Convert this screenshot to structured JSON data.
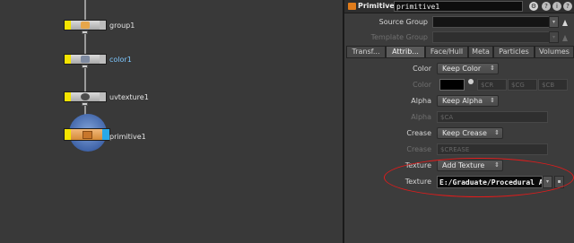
{
  "network": {
    "nodes": [
      {
        "name": "group1"
      },
      {
        "name": "color1"
      },
      {
        "name": "uvtexture1"
      },
      {
        "name": "primitive1"
      }
    ]
  },
  "panel": {
    "node_type": "Primitive",
    "node_name": "primitive1",
    "source_group_label": "Source Group",
    "template_group_label": "Template Group",
    "tabs": [
      "Transf...",
      "Attrib...",
      "Face/Hull",
      "Meta",
      "Particles",
      "Volumes"
    ],
    "active_tab": "Attrib...",
    "params": {
      "color_mode_label": "Color",
      "color_mode_value": "Keep Color",
      "color_label": "Color",
      "color_fields": [
        "$CR",
        "$CG",
        "$CB"
      ],
      "alpha_mode_label": "Alpha",
      "alpha_mode_value": "Keep Alpha",
      "alpha_label": "Alpha",
      "alpha_field": "$CA",
      "crease_mode_label": "Crease",
      "crease_mode_value": "Keep Crease",
      "crease_label": "Crease",
      "crease_field": "$CREASE",
      "texture_mode_label": "Texture",
      "texture_mode_value": "Add Texture",
      "texture_label": "Texture",
      "texture_value": "E:/Graduate/Procedural Ani"
    }
  },
  "colors": {
    "display_flag": "#f5e400",
    "render_flag": "#2aa9e8",
    "annotation": "#e21b1b",
    "sop_orange": "#e07c1b"
  }
}
